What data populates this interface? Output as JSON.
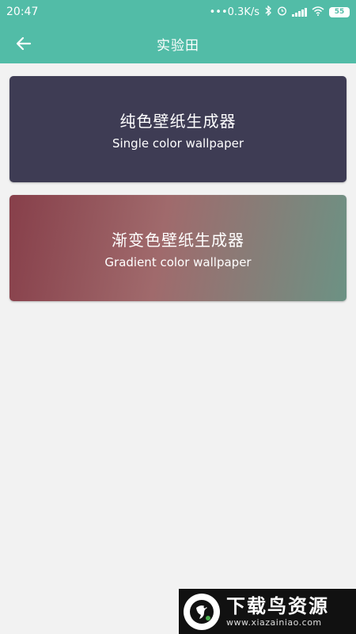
{
  "status_bar": {
    "time": "20:47",
    "network_speed": "•••0.3K/s",
    "battery": "55",
    "icons": [
      "bluetooth-icon",
      "alarm-icon",
      "signal-icon",
      "wifi-icon",
      "battery-icon"
    ]
  },
  "app_bar": {
    "title": "实验田",
    "back_icon": "arrow-left-icon"
  },
  "cards": [
    {
      "title": "纯色壁纸生成器",
      "subtitle": "Single color wallpaper",
      "color": "#3e3c54"
    },
    {
      "title": "渐变色壁纸生成器",
      "subtitle": "Gradient color wallpaper",
      "gradient": [
        "#873f4a",
        "#6c9284"
      ]
    }
  ],
  "watermark": {
    "name": "下载鸟资源",
    "url": "www.xiazainiao.com"
  },
  "colors": {
    "accent": "#52bca7",
    "background": "#f2f2f2"
  }
}
